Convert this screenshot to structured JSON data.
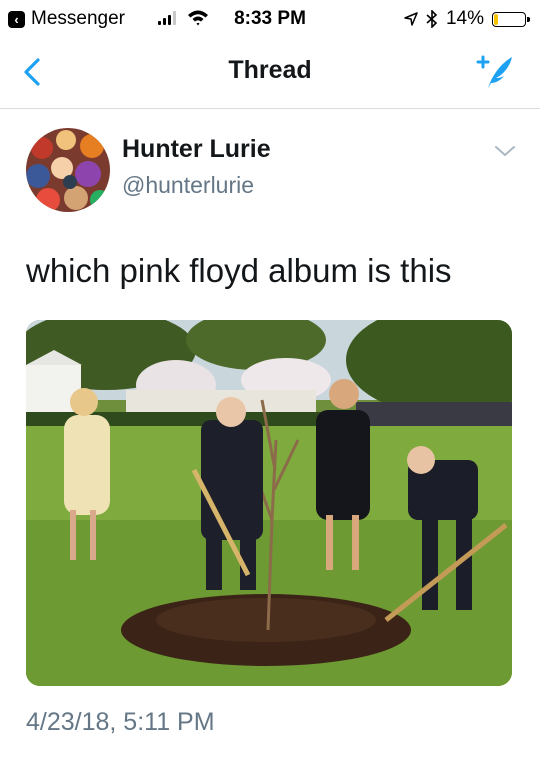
{
  "status_bar": {
    "back_app": "Messenger",
    "time": "8:33 PM",
    "battery": "14%",
    "battery_level": 0.14
  },
  "nav": {
    "title": "Thread"
  },
  "tweet": {
    "display_name": "Hunter Lurie",
    "handle": "@hunterlurie",
    "text": "which pink floyd album is this",
    "timestamp": "4/23/18, 5:11 PM"
  },
  "colors": {
    "accent": "#1da1f2",
    "secondary_text": "#657786",
    "primary_text": "#14171a"
  }
}
